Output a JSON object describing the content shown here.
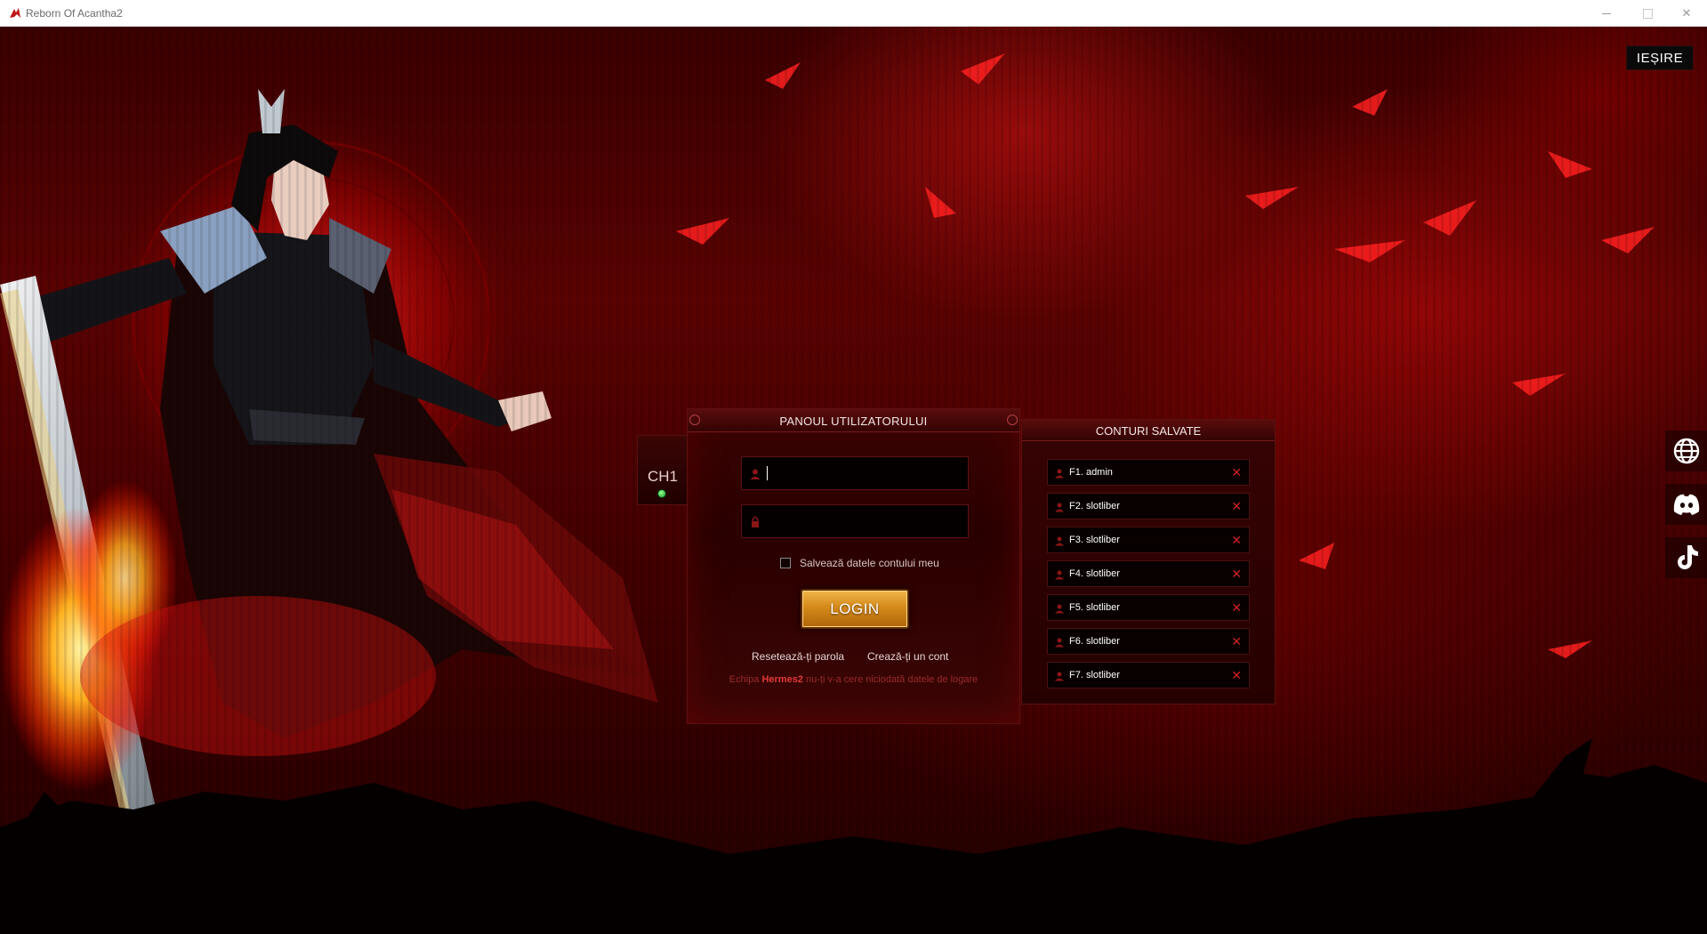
{
  "window": {
    "title": "Reborn Of Acantha2"
  },
  "exit_button": "IEȘIRE",
  "channel": {
    "label": "CH1",
    "status_color": "#2fcf3a"
  },
  "login_panel": {
    "title": "PANOUL UTILIZATORULUI",
    "username_value": "",
    "password_value": "",
    "remember_label": "Salvează datele contului meu",
    "remember_checked": false,
    "login_label": "LOGIN",
    "reset_link": "Resetează-ți parola",
    "create_link": "Crează-ți un cont",
    "warning_prefix": "Echipa ",
    "warning_brand": "Hermes2",
    "warning_suffix": " nu-ți v-a cere niciodată datele de logare"
  },
  "saved_accounts": {
    "title": "CONTURI SALVATE",
    "items": [
      {
        "label": "F1. admin"
      },
      {
        "label": "F2. slotliber"
      },
      {
        "label": "F3. slotliber"
      },
      {
        "label": "F4. slotliber"
      },
      {
        "label": "F5. slotliber"
      },
      {
        "label": "F6. slotliber"
      },
      {
        "label": "F7. slotliber"
      }
    ]
  },
  "social_links": [
    {
      "icon": "globe-icon"
    },
    {
      "icon": "discord-icon"
    },
    {
      "icon": "tiktok-icon"
    }
  ],
  "colors": {
    "accent_red": "#c81010",
    "button_gold": "#d58a1a",
    "panel_bg": "#2a0000"
  }
}
